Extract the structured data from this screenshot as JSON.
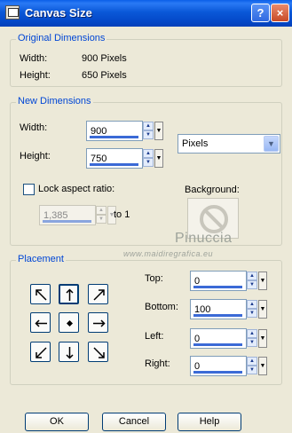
{
  "window": {
    "title": "Canvas Size",
    "help_label": "?",
    "close_label": "×",
    "icon": "canvas-app-icon"
  },
  "original": {
    "title": "Original Dimensions",
    "width_label": "Width:",
    "width_value": "900 Pixels",
    "height_label": "Height:",
    "height_value": "650 Pixels"
  },
  "new_dims": {
    "title": "New Dimensions",
    "width_label": "Width:",
    "width_value": "900",
    "height_label": "Height:",
    "height_value": "750",
    "units_value": "Pixels",
    "lock_label": "Lock aspect ratio:",
    "lock_checked": false,
    "ratio_value": "1,385",
    "to_label": "to 1",
    "background_label": "Background:",
    "background_icon": "none-icon"
  },
  "watermark": {
    "name": "Pinuccia",
    "url": "www.maidiregrafica.eu"
  },
  "placement": {
    "title": "Placement",
    "top_label": "Top:",
    "top_value": "0",
    "bottom_label": "Bottom:",
    "bottom_value": "100",
    "left_label": "Left:",
    "left_value": "0",
    "right_label": "Right:",
    "right_value": "0",
    "selected": "top-center"
  },
  "buttons": {
    "ok": "OK",
    "cancel": "Cancel",
    "help": "Help"
  },
  "colors": {
    "accent": "#0046d5",
    "field_border": "#7f9db9",
    "title_bar": "#0a58d8",
    "face": "#ece9d8"
  }
}
